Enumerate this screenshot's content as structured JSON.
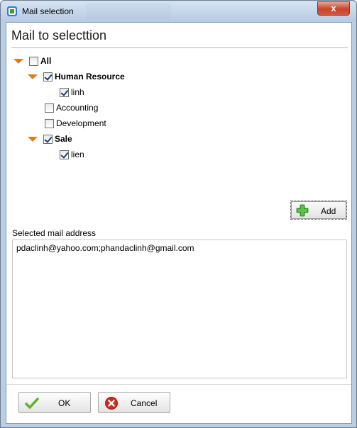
{
  "window": {
    "title": "Mail selection",
    "close_label": "x"
  },
  "heading": "Mail to selecttion",
  "tree": {
    "all": {
      "label": "All",
      "checked": false
    },
    "groups": [
      {
        "label": "Human Resource",
        "checked": true,
        "expanded": true,
        "children": [
          {
            "label": "linh",
            "checked": true
          }
        ]
      },
      {
        "label": "Accounting",
        "checked": false,
        "expanded": false,
        "children": []
      },
      {
        "label": "Development",
        "checked": false,
        "expanded": false,
        "children": []
      },
      {
        "label": "Sale",
        "checked": true,
        "expanded": true,
        "children": [
          {
            "label": "lien",
            "checked": true
          }
        ]
      }
    ]
  },
  "add_button": {
    "label": "Add",
    "icon": "plus-icon"
  },
  "selected_mail": {
    "label": "Selected mail address",
    "value": "pdaclinh@yahoo.com;phandaclinh@gmail.com"
  },
  "buttons": {
    "ok": {
      "label": "OK",
      "icon": "checkmark-icon"
    },
    "cancel": {
      "label": "Cancel",
      "icon": "cancel-icon"
    }
  },
  "colors": {
    "expander": "#e07a1f",
    "add_icon": "#3aa12b",
    "ok_icon": "#5cb32c",
    "cancel_icon": "#d12a1f"
  }
}
